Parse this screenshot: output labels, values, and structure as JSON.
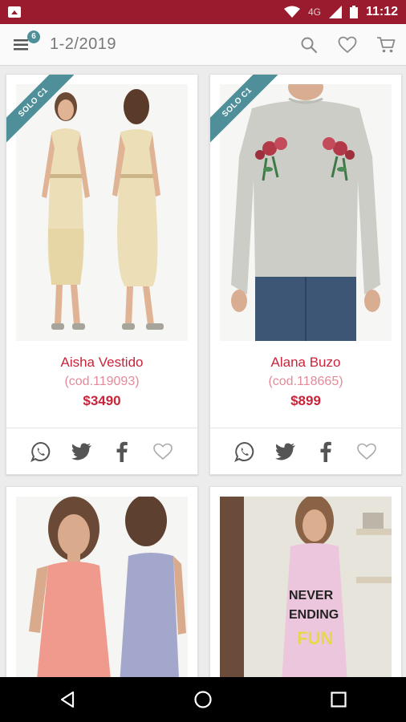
{
  "status_bar": {
    "network": "4G",
    "time": "11:12"
  },
  "toolbar": {
    "menu_badge": "6",
    "title": "1-2/2019"
  },
  "products": [
    {
      "ribbon": "SOLO C1",
      "name": "Aisha Vestido",
      "code": "(cod.119093)",
      "price": "$3490"
    },
    {
      "ribbon": "SOLO C1",
      "name": "Alana Buzo",
      "code": "(cod.118665)",
      "price": "$899"
    }
  ],
  "colors": {
    "status_bar": "#9b1b2e",
    "accent_red": "#c8243a",
    "code_pink": "#e58a98",
    "badge_teal": "#4e8f99"
  },
  "icons": {
    "status_bar": [
      "image-notification-icon",
      "wifi-icon",
      "cell-signal-icon",
      "battery-icon"
    ],
    "toolbar": [
      "menu-icon",
      "search-icon",
      "heart-icon",
      "cart-icon"
    ],
    "card_actions": [
      "whatsapp-icon",
      "twitter-icon",
      "facebook-icon",
      "heart-icon"
    ],
    "navbar": [
      "back-icon",
      "home-icon",
      "recents-icon"
    ]
  }
}
